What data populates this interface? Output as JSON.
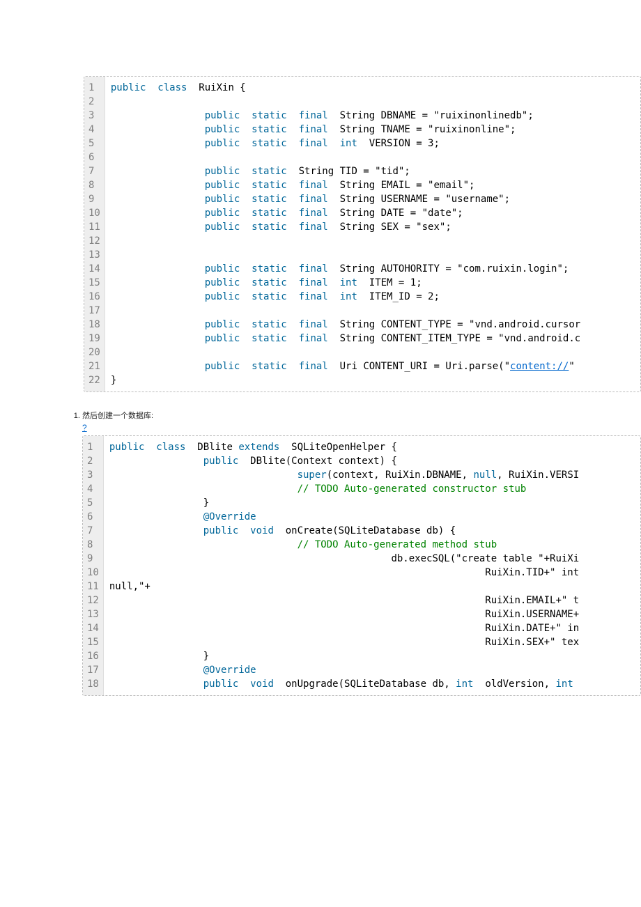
{
  "block1": {
    "gutter": [
      "1",
      "2",
      "3",
      "4",
      "5",
      "6",
      "7",
      "8",
      "9",
      "10",
      "11",
      "12",
      "13",
      "14",
      "15",
      "16",
      "17",
      "18",
      "19",
      "20",
      "21",
      "22"
    ],
    "lines": [
      [
        [
          "kw",
          "public"
        ],
        [
          "",
          "  "
        ],
        [
          "kw",
          "class"
        ],
        [
          "",
          "  RuiXin {"
        ]
      ],
      [
        [
          "",
          ""
        ]
      ],
      [
        [
          "",
          "                "
        ],
        [
          "kw",
          "public"
        ],
        [
          "",
          "  "
        ],
        [
          "kw",
          "static"
        ],
        [
          "",
          "  "
        ],
        [
          "kw",
          "final"
        ],
        [
          "",
          "  String DBNAME = \"ruixinonlinedb\";"
        ]
      ],
      [
        [
          "",
          "                "
        ],
        [
          "kw",
          "public"
        ],
        [
          "",
          "  "
        ],
        [
          "kw",
          "static"
        ],
        [
          "",
          "  "
        ],
        [
          "kw",
          "final"
        ],
        [
          "",
          "  String TNAME = \"ruixinonline\";"
        ]
      ],
      [
        [
          "",
          "                "
        ],
        [
          "kw",
          "public"
        ],
        [
          "",
          "  "
        ],
        [
          "kw",
          "static"
        ],
        [
          "",
          "  "
        ],
        [
          "kw",
          "final"
        ],
        [
          "",
          "  "
        ],
        [
          "kw",
          "int"
        ],
        [
          "",
          "  VERSION = 3;"
        ]
      ],
      [
        [
          "",
          ""
        ]
      ],
      [
        [
          "",
          "                "
        ],
        [
          "kw",
          "public"
        ],
        [
          "",
          "  "
        ],
        [
          "kw",
          "static"
        ],
        [
          "",
          "  String TID = \"tid\";"
        ]
      ],
      [
        [
          "",
          "                "
        ],
        [
          "kw",
          "public"
        ],
        [
          "",
          "  "
        ],
        [
          "kw",
          "static"
        ],
        [
          "",
          "  "
        ],
        [
          "kw",
          "final"
        ],
        [
          "",
          "  String EMAIL = \"email\";"
        ]
      ],
      [
        [
          "",
          "                "
        ],
        [
          "kw",
          "public"
        ],
        [
          "",
          "  "
        ],
        [
          "kw",
          "static"
        ],
        [
          "",
          "  "
        ],
        [
          "kw",
          "final"
        ],
        [
          "",
          "  String USERNAME = \"username\";"
        ]
      ],
      [
        [
          "",
          "                "
        ],
        [
          "kw",
          "public"
        ],
        [
          "",
          "  "
        ],
        [
          "kw",
          "static"
        ],
        [
          "",
          "  "
        ],
        [
          "kw",
          "final"
        ],
        [
          "",
          "  String DATE = \"date\";"
        ]
      ],
      [
        [
          "",
          "                "
        ],
        [
          "kw",
          "public"
        ],
        [
          "",
          "  "
        ],
        [
          "kw",
          "static"
        ],
        [
          "",
          "  "
        ],
        [
          "kw",
          "final"
        ],
        [
          "",
          "  String SEX = \"sex\";"
        ]
      ],
      [
        [
          "",
          ""
        ]
      ],
      [
        [
          "",
          ""
        ]
      ],
      [
        [
          "",
          "                "
        ],
        [
          "kw",
          "public"
        ],
        [
          "",
          "  "
        ],
        [
          "kw",
          "static"
        ],
        [
          "",
          "  "
        ],
        [
          "kw",
          "final"
        ],
        [
          "",
          "  String AUTOHORITY = \"com.ruixin.login\";"
        ]
      ],
      [
        [
          "",
          "                "
        ],
        [
          "kw",
          "public"
        ],
        [
          "",
          "  "
        ],
        [
          "kw",
          "static"
        ],
        [
          "",
          "  "
        ],
        [
          "kw",
          "final"
        ],
        [
          "",
          "  "
        ],
        [
          "kw",
          "int"
        ],
        [
          "",
          "  ITEM = 1;"
        ]
      ],
      [
        [
          "",
          "                "
        ],
        [
          "kw",
          "public"
        ],
        [
          "",
          "  "
        ],
        [
          "kw",
          "static"
        ],
        [
          "",
          "  "
        ],
        [
          "kw",
          "final"
        ],
        [
          "",
          "  "
        ],
        [
          "kw",
          "int"
        ],
        [
          "",
          "  ITEM_ID = 2;"
        ]
      ],
      [
        [
          "",
          ""
        ]
      ],
      [
        [
          "",
          "                "
        ],
        [
          "kw",
          "public"
        ],
        [
          "",
          "  "
        ],
        [
          "kw",
          "static"
        ],
        [
          "",
          "  "
        ],
        [
          "kw",
          "final"
        ],
        [
          "",
          "  String CONTENT_TYPE = \"vnd.android.cursor"
        ]
      ],
      [
        [
          "",
          "                "
        ],
        [
          "kw",
          "public"
        ],
        [
          "",
          "  "
        ],
        [
          "kw",
          "static"
        ],
        [
          "",
          "  "
        ],
        [
          "kw",
          "final"
        ],
        [
          "",
          "  String CONTENT_ITEM_TYPE = \"vnd.android.c"
        ]
      ],
      [
        [
          "",
          ""
        ]
      ],
      [
        [
          "",
          "                "
        ],
        [
          "kw",
          "public"
        ],
        [
          "",
          "  "
        ],
        [
          "kw",
          "static"
        ],
        [
          "",
          "  "
        ],
        [
          "kw",
          "final"
        ],
        [
          "",
          "  Uri CONTENT_URI = Uri.parse(\""
        ],
        [
          "lnk",
          "content://"
        ],
        [
          "",
          "\""
        ]
      ],
      [
        [
          "",
          "}"
        ]
      ]
    ]
  },
  "section1": {
    "label": "然后创建一个数据库:",
    "qmark": "?"
  },
  "block2": {
    "gutter": [
      "1",
      "2",
      "3",
      "4",
      "5",
      "6",
      "7",
      "8",
      "9",
      "10",
      "11",
      "12",
      "13",
      "14",
      "15",
      "16",
      "17",
      "18"
    ],
    "lines": [
      [
        [
          "kw",
          "public"
        ],
        [
          "",
          "  "
        ],
        [
          "kw",
          "class"
        ],
        [
          "",
          "  DBlite "
        ],
        [
          "kw",
          "extends"
        ],
        [
          "",
          "  SQLiteOpenHelper {"
        ]
      ],
      [
        [
          "",
          "                "
        ],
        [
          "kw",
          "public"
        ],
        [
          "",
          "  DBlite(Context context) {"
        ]
      ],
      [
        [
          "",
          "                                "
        ],
        [
          "kw",
          "super"
        ],
        [
          "",
          "(context, RuiXin.DBNAME, "
        ],
        [
          "kw",
          "null"
        ],
        [
          "",
          ", RuiXin.VERSI"
        ]
      ],
      [
        [
          "",
          "                                "
        ],
        [
          "cm",
          "// TODO Auto-generated constructor stub"
        ]
      ],
      [
        [
          "",
          "                }"
        ]
      ],
      [
        [
          "",
          "                "
        ],
        [
          "kw",
          "@Override"
        ]
      ],
      [
        [
          "",
          "                "
        ],
        [
          "kw",
          "public"
        ],
        [
          "",
          "  "
        ],
        [
          "kw",
          "void"
        ],
        [
          "",
          "  onCreate(SQLiteDatabase db) {"
        ]
      ],
      [
        [
          "",
          "                                "
        ],
        [
          "cm",
          "// TODO Auto-generated method stub"
        ]
      ],
      [
        [
          "",
          "                                                db.execSQL(\"create table \"+RuiXi"
        ]
      ],
      [
        [
          "",
          "                                                                RuiXin.TID+\" int"
        ]
      ],
      [
        [
          "",
          "null,\"+"
        ]
      ],
      [
        [
          "",
          "                                                                RuiXin.EMAIL+\" t"
        ]
      ],
      [
        [
          "",
          "                                                                RuiXin.USERNAME+"
        ]
      ],
      [
        [
          "",
          "                                                                RuiXin.DATE+\" in"
        ]
      ],
      [
        [
          "",
          "                                                                RuiXin.SEX+\" tex"
        ]
      ],
      [
        [
          "",
          "                }"
        ]
      ],
      [
        [
          "",
          "                "
        ],
        [
          "kw",
          "@Override"
        ]
      ],
      [
        [
          "",
          "                "
        ],
        [
          "kw",
          "public"
        ],
        [
          "",
          "  "
        ],
        [
          "kw",
          "void"
        ],
        [
          "",
          "  onUpgrade(SQLiteDatabase db, "
        ],
        [
          "kw",
          "int"
        ],
        [
          "",
          "  oldVersion, "
        ],
        [
          "kw",
          "int"
        ],
        [
          "",
          " "
        ]
      ]
    ]
  }
}
